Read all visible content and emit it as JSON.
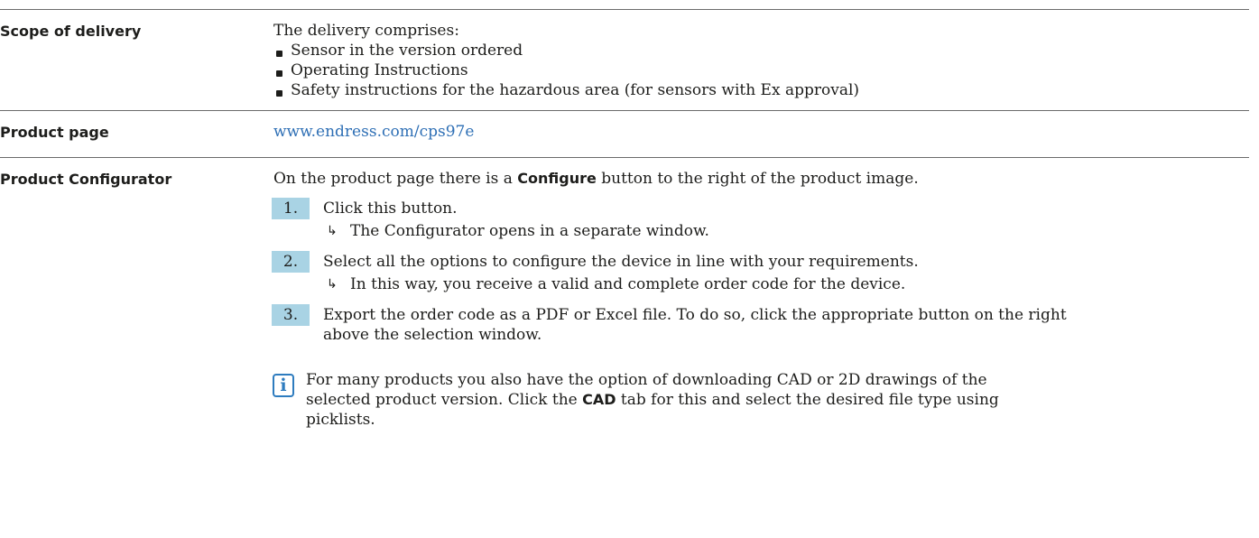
{
  "scope": {
    "label": "Scope of delivery",
    "intro": "The delivery comprises:",
    "items": [
      "Sensor in the version ordered",
      "Operating Instructions",
      "Safety instructions for the hazardous area (for sensors with Ex approval)"
    ]
  },
  "product_page": {
    "label": "Product page",
    "link": "www.endress.com/cps97e"
  },
  "configurator": {
    "label": "Product Configurator",
    "intro_before": "On the product page there is a ",
    "intro_bold": "Configure",
    "intro_after": " button to the right of the product image.",
    "steps": [
      {
        "num": "1.",
        "text": "Click this button.",
        "result": "The Configurator opens in a separate window."
      },
      {
        "num": "2.",
        "text": "Select all the options to configure the device in line with your requirements.",
        "result": "In this way, you receive a valid and complete order code for the device."
      },
      {
        "num": "3.",
        "text_line1": "Export the order code as a PDF or Excel file. To do so, click the appropriate button on the right",
        "text_line2": "above the selection window."
      }
    ],
    "note": {
      "line1": "For many products you also have the option of downloading CAD or 2D drawings of the",
      "line2_before": "selected product version. Click the ",
      "line2_bold": "CAD",
      "line2_after": " tab for this and select the desired file type using",
      "line3": "picklists.",
      "icon": "info-icon"
    }
  }
}
